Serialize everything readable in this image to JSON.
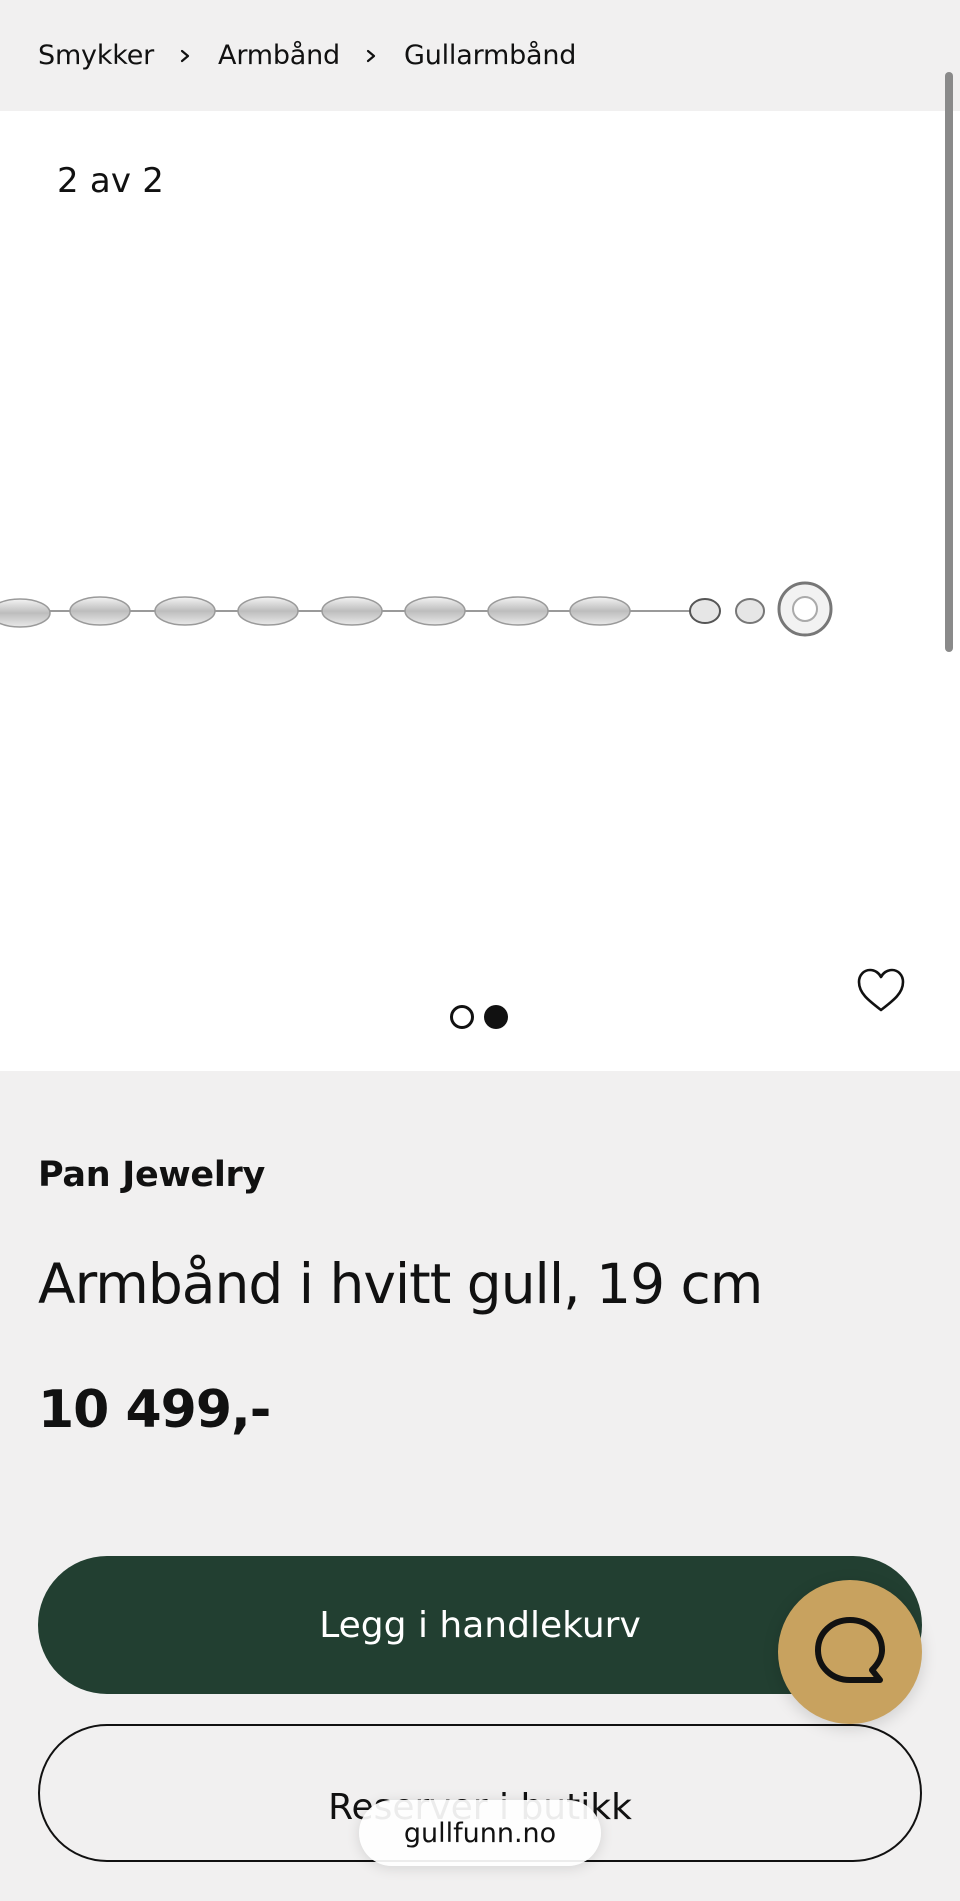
{
  "breadcrumb": {
    "items": [
      "Smykker",
      "Armbånd",
      "Gullarmbånd"
    ]
  },
  "gallery": {
    "counter": "2 av 2",
    "total_images": 2,
    "current_image": 2,
    "favorite_icon": "heart-outline-icon"
  },
  "product": {
    "brand": "Pan Jewelry",
    "title": "Armbånd i hvitt gull, 19 cm",
    "price": "10 499,-"
  },
  "actions": {
    "add_to_cart": "Legg i handlekurv",
    "reserve": "Reserver i butikk"
  },
  "chat": {
    "icon": "chat-bubble-icon"
  },
  "browser": {
    "url": "gullfunn.no"
  },
  "colors": {
    "primary_button": "#223f31",
    "chat_button": "#c8a25f",
    "background": "#f1f0f0"
  }
}
